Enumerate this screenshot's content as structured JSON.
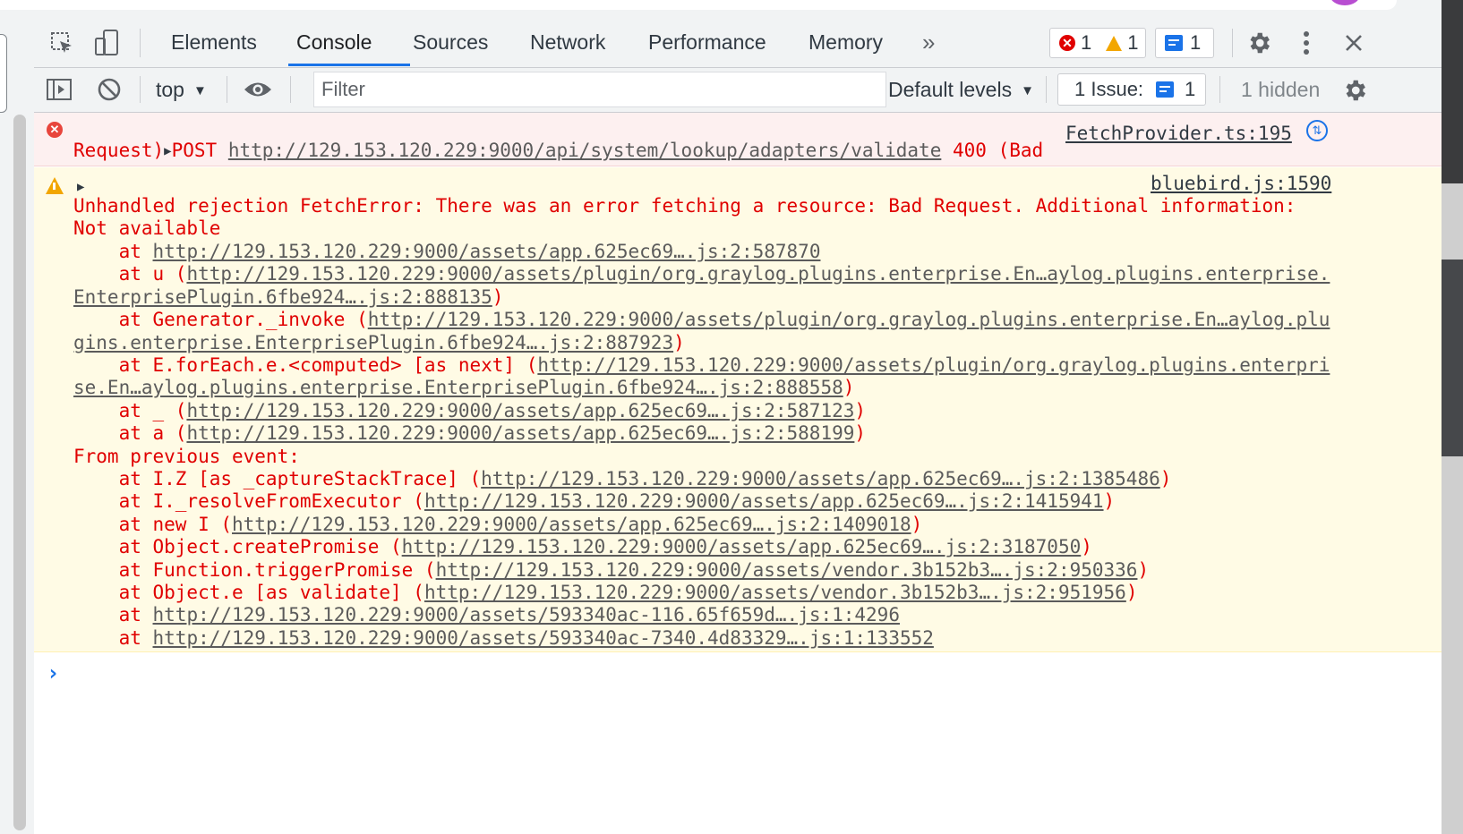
{
  "tabs": {
    "elements": "Elements",
    "console": "Console",
    "sources": "Sources",
    "network": "Network",
    "performance": "Performance",
    "memory": "Memory",
    "more": "»"
  },
  "counters": {
    "errors": "1",
    "warnings": "1",
    "messages": "1"
  },
  "toolbar": {
    "context": "top",
    "filter_placeholder": "Filter",
    "default_levels": "Default levels",
    "issues_label": "1 Issue:",
    "issues_count": "1",
    "hidden": "1 hidden"
  },
  "error_msg": {
    "method": "POST",
    "url": "http://129.153.120.229:9000/api/system/lookup/adapters/validate",
    "status": "400 (Bad",
    "status2": "Request)",
    "source": "FetchProvider.ts:195"
  },
  "warn_msg": {
    "source": "bluebird.js:1590",
    "line1": "Unhandled rejection FetchError: There was an error fetching a resource: Bad Request. Additional information:",
    "line2": "Not available",
    "stack": [
      {
        "pre": "    at ",
        "url": "http://129.153.120.229:9000/assets/app.625ec69….js:2:587870",
        "post": ""
      },
      {
        "pre": "    at u (",
        "url": "http://129.153.120.229:9000/assets/plugin/org.graylog.plugins.enterprise.En…aylog.plugins.enterprise.",
        "post": ""
      },
      {
        "pre": "",
        "url": "EnterprisePlugin.6fbe924….js:2:888135",
        "post": ")"
      },
      {
        "pre": "    at Generator._invoke (",
        "url": "http://129.153.120.229:9000/assets/plugin/org.graylog.plugins.enterprise.En…aylog.plu",
        "post": ""
      },
      {
        "pre": "",
        "url": "gins.enterprise.EnterprisePlugin.6fbe924….js:2:887923",
        "post": ")"
      },
      {
        "pre": "    at E.forEach.e.<computed> [as next] (",
        "url": "http://129.153.120.229:9000/assets/plugin/org.graylog.plugins.enterpri",
        "post": ""
      },
      {
        "pre": "",
        "url": "se.En…aylog.plugins.enterprise.EnterprisePlugin.6fbe924….js:2:888558",
        "post": ")"
      },
      {
        "pre": "    at _ (",
        "url": "http://129.153.120.229:9000/assets/app.625ec69….js:2:587123",
        "post": ")"
      },
      {
        "pre": "    at a (",
        "url": "http://129.153.120.229:9000/assets/app.625ec69….js:2:588199",
        "post": ")"
      },
      {
        "pre": "From previous event:",
        "url": "",
        "post": ""
      },
      {
        "pre": "    at I.Z [as _captureStackTrace] (",
        "url": "http://129.153.120.229:9000/assets/app.625ec69….js:2:1385486",
        "post": ")"
      },
      {
        "pre": "    at I._resolveFromExecutor (",
        "url": "http://129.153.120.229:9000/assets/app.625ec69….js:2:1415941",
        "post": ")"
      },
      {
        "pre": "    at new I (",
        "url": "http://129.153.120.229:9000/assets/app.625ec69….js:2:1409018",
        "post": ")"
      },
      {
        "pre": "    at Object.createPromise (",
        "url": "http://129.153.120.229:9000/assets/app.625ec69….js:2:3187050",
        "post": ")"
      },
      {
        "pre": "    at Function.triggerPromise (",
        "url": "http://129.153.120.229:9000/assets/vendor.3b152b3….js:2:950336",
        "post": ")"
      },
      {
        "pre": "    at Object.e [as validate] (",
        "url": "http://129.153.120.229:9000/assets/vendor.3b152b3….js:2:951956",
        "post": ")"
      },
      {
        "pre": "    at ",
        "url": "http://129.153.120.229:9000/assets/593340ac-116.65f659d….js:1:4296",
        "post": ""
      },
      {
        "pre": "    at ",
        "url": "http://129.153.120.229:9000/assets/593340ac-7340.4d83329….js:1:133552",
        "post": ""
      }
    ]
  },
  "colors": {
    "error_bg": "#fdf0f0",
    "warn_bg": "#fffbe5",
    "error_text": "#e00000",
    "accent": "#1a73e8"
  }
}
